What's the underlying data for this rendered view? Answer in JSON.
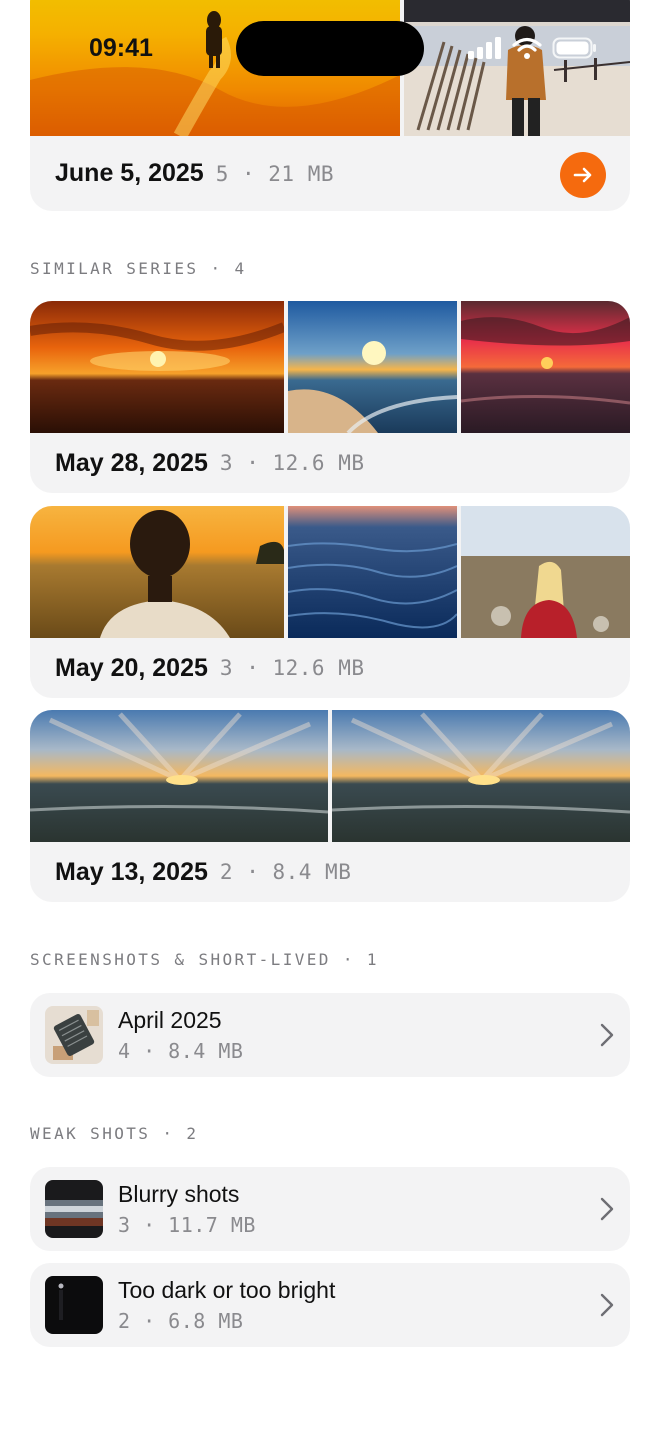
{
  "status_bar": {
    "time": "09:41"
  },
  "top_card": {
    "date": "June 5, 2025",
    "meta": "5 · 21 MB",
    "next_icon": "arrow-right-icon",
    "accent": "#f56a0e"
  },
  "similar_series": {
    "label": "SIMILAR SERIES · 4",
    "groups": [
      {
        "date": "May 28, 2025",
        "meta": "3 · 12.6 MB"
      },
      {
        "date": "May 20, 2025",
        "meta": "3 · 12.6 MB"
      },
      {
        "date": "May 13, 2025",
        "meta": "2 · 8.4 MB"
      }
    ]
  },
  "screenshots": {
    "label": "SCREENSHOTS & SHORT-LIVED · 1",
    "items": [
      {
        "title": "April 2025",
        "meta": "4 · 8.4 MB"
      }
    ]
  },
  "weak_shots": {
    "label": "WEAK SHOTS · 2",
    "items": [
      {
        "title": "Blurry shots",
        "meta": "3 · 11.7 MB"
      },
      {
        "title": "Too dark or too bright",
        "meta": "2 · 6.8 MB"
      }
    ]
  }
}
